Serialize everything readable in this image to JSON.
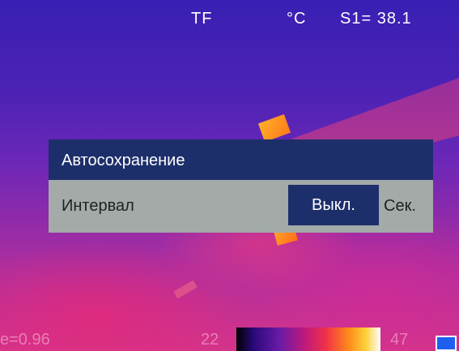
{
  "status": {
    "mode": "TF",
    "unit": "°C",
    "spot_reading": "S1= 38.1"
  },
  "dialog": {
    "title": "Автосохранение",
    "row": {
      "label": "Интервал",
      "value": "Выкл.",
      "unit": "Сек."
    }
  },
  "footer": {
    "emissivity": "e=0.96",
    "scale_min": "22",
    "scale_max": "47"
  },
  "colors": {
    "dialog_header": "#1d2f6b",
    "dialog_body": "#a3aaa8",
    "selected_value": "#1d2f6b",
    "indicator_blue": "#1e5ff0"
  },
  "icons": {
    "color_scale": "palette-scale-bar",
    "indicator": "blue-square-indicator"
  }
}
